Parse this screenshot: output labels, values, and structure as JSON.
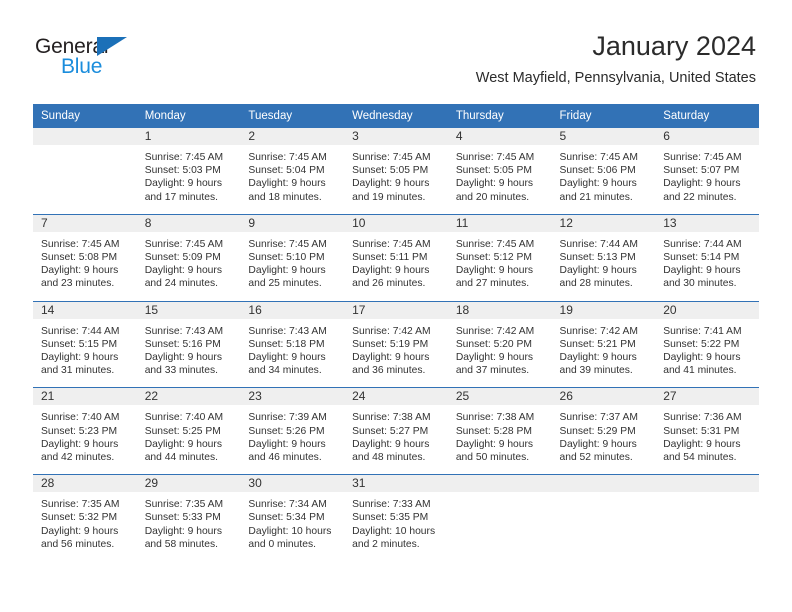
{
  "brand": {
    "line1": "General",
    "line2": "Blue",
    "triangle_color": "#1b70b8",
    "blue_color": "#1b8ddc"
  },
  "header": {
    "month_title": "January 2024",
    "location": "West Mayfield, Pennsylvania, United States"
  },
  "theme": {
    "header_blue": "#3272b6",
    "daynum_band": "#efefef",
    "text": "#333333"
  },
  "weekday_headers": [
    "Sunday",
    "Monday",
    "Tuesday",
    "Wednesday",
    "Thursday",
    "Friday",
    "Saturday"
  ],
  "weeks": [
    [
      {
        "day": "",
        "empty": true,
        "sunrise": "",
        "sunset": "",
        "daylight_line1": "",
        "daylight_line2": ""
      },
      {
        "day": "1",
        "sunrise": "Sunrise: 7:45 AM",
        "sunset": "Sunset: 5:03 PM",
        "daylight_line1": "Daylight: 9 hours",
        "daylight_line2": "and 17 minutes."
      },
      {
        "day": "2",
        "sunrise": "Sunrise: 7:45 AM",
        "sunset": "Sunset: 5:04 PM",
        "daylight_line1": "Daylight: 9 hours",
        "daylight_line2": "and 18 minutes."
      },
      {
        "day": "3",
        "sunrise": "Sunrise: 7:45 AM",
        "sunset": "Sunset: 5:05 PM",
        "daylight_line1": "Daylight: 9 hours",
        "daylight_line2": "and 19 minutes."
      },
      {
        "day": "4",
        "sunrise": "Sunrise: 7:45 AM",
        "sunset": "Sunset: 5:05 PM",
        "daylight_line1": "Daylight: 9 hours",
        "daylight_line2": "and 20 minutes."
      },
      {
        "day": "5",
        "sunrise": "Sunrise: 7:45 AM",
        "sunset": "Sunset: 5:06 PM",
        "daylight_line1": "Daylight: 9 hours",
        "daylight_line2": "and 21 minutes."
      },
      {
        "day": "6",
        "sunrise": "Sunrise: 7:45 AM",
        "sunset": "Sunset: 5:07 PM",
        "daylight_line1": "Daylight: 9 hours",
        "daylight_line2": "and 22 minutes."
      }
    ],
    [
      {
        "day": "7",
        "sunrise": "Sunrise: 7:45 AM",
        "sunset": "Sunset: 5:08 PM",
        "daylight_line1": "Daylight: 9 hours",
        "daylight_line2": "and 23 minutes."
      },
      {
        "day": "8",
        "sunrise": "Sunrise: 7:45 AM",
        "sunset": "Sunset: 5:09 PM",
        "daylight_line1": "Daylight: 9 hours",
        "daylight_line2": "and 24 minutes."
      },
      {
        "day": "9",
        "sunrise": "Sunrise: 7:45 AM",
        "sunset": "Sunset: 5:10 PM",
        "daylight_line1": "Daylight: 9 hours",
        "daylight_line2": "and 25 minutes."
      },
      {
        "day": "10",
        "sunrise": "Sunrise: 7:45 AM",
        "sunset": "Sunset: 5:11 PM",
        "daylight_line1": "Daylight: 9 hours",
        "daylight_line2": "and 26 minutes."
      },
      {
        "day": "11",
        "sunrise": "Sunrise: 7:45 AM",
        "sunset": "Sunset: 5:12 PM",
        "daylight_line1": "Daylight: 9 hours",
        "daylight_line2": "and 27 minutes."
      },
      {
        "day": "12",
        "sunrise": "Sunrise: 7:44 AM",
        "sunset": "Sunset: 5:13 PM",
        "daylight_line1": "Daylight: 9 hours",
        "daylight_line2": "and 28 minutes."
      },
      {
        "day": "13",
        "sunrise": "Sunrise: 7:44 AM",
        "sunset": "Sunset: 5:14 PM",
        "daylight_line1": "Daylight: 9 hours",
        "daylight_line2": "and 30 minutes."
      }
    ],
    [
      {
        "day": "14",
        "sunrise": "Sunrise: 7:44 AM",
        "sunset": "Sunset: 5:15 PM",
        "daylight_line1": "Daylight: 9 hours",
        "daylight_line2": "and 31 minutes."
      },
      {
        "day": "15",
        "sunrise": "Sunrise: 7:43 AM",
        "sunset": "Sunset: 5:16 PM",
        "daylight_line1": "Daylight: 9 hours",
        "daylight_line2": "and 33 minutes."
      },
      {
        "day": "16",
        "sunrise": "Sunrise: 7:43 AM",
        "sunset": "Sunset: 5:18 PM",
        "daylight_line1": "Daylight: 9 hours",
        "daylight_line2": "and 34 minutes."
      },
      {
        "day": "17",
        "sunrise": "Sunrise: 7:42 AM",
        "sunset": "Sunset: 5:19 PM",
        "daylight_line1": "Daylight: 9 hours",
        "daylight_line2": "and 36 minutes."
      },
      {
        "day": "18",
        "sunrise": "Sunrise: 7:42 AM",
        "sunset": "Sunset: 5:20 PM",
        "daylight_line1": "Daylight: 9 hours",
        "daylight_line2": "and 37 minutes."
      },
      {
        "day": "19",
        "sunrise": "Sunrise: 7:42 AM",
        "sunset": "Sunset: 5:21 PM",
        "daylight_line1": "Daylight: 9 hours",
        "daylight_line2": "and 39 minutes."
      },
      {
        "day": "20",
        "sunrise": "Sunrise: 7:41 AM",
        "sunset": "Sunset: 5:22 PM",
        "daylight_line1": "Daylight: 9 hours",
        "daylight_line2": "and 41 minutes."
      }
    ],
    [
      {
        "day": "21",
        "sunrise": "Sunrise: 7:40 AM",
        "sunset": "Sunset: 5:23 PM",
        "daylight_line1": "Daylight: 9 hours",
        "daylight_line2": "and 42 minutes."
      },
      {
        "day": "22",
        "sunrise": "Sunrise: 7:40 AM",
        "sunset": "Sunset: 5:25 PM",
        "daylight_line1": "Daylight: 9 hours",
        "daylight_line2": "and 44 minutes."
      },
      {
        "day": "23",
        "sunrise": "Sunrise: 7:39 AM",
        "sunset": "Sunset: 5:26 PM",
        "daylight_line1": "Daylight: 9 hours",
        "daylight_line2": "and 46 minutes."
      },
      {
        "day": "24",
        "sunrise": "Sunrise: 7:38 AM",
        "sunset": "Sunset: 5:27 PM",
        "daylight_line1": "Daylight: 9 hours",
        "daylight_line2": "and 48 minutes."
      },
      {
        "day": "25",
        "sunrise": "Sunrise: 7:38 AM",
        "sunset": "Sunset: 5:28 PM",
        "daylight_line1": "Daylight: 9 hours",
        "daylight_line2": "and 50 minutes."
      },
      {
        "day": "26",
        "sunrise": "Sunrise: 7:37 AM",
        "sunset": "Sunset: 5:29 PM",
        "daylight_line1": "Daylight: 9 hours",
        "daylight_line2": "and 52 minutes."
      },
      {
        "day": "27",
        "sunrise": "Sunrise: 7:36 AM",
        "sunset": "Sunset: 5:31 PM",
        "daylight_line1": "Daylight: 9 hours",
        "daylight_line2": "and 54 minutes."
      }
    ],
    [
      {
        "day": "28",
        "sunrise": "Sunrise: 7:35 AM",
        "sunset": "Sunset: 5:32 PM",
        "daylight_line1": "Daylight: 9 hours",
        "daylight_line2": "and 56 minutes."
      },
      {
        "day": "29",
        "sunrise": "Sunrise: 7:35 AM",
        "sunset": "Sunset: 5:33 PM",
        "daylight_line1": "Daylight: 9 hours",
        "daylight_line2": "and 58 minutes."
      },
      {
        "day": "30",
        "sunrise": "Sunrise: 7:34 AM",
        "sunset": "Sunset: 5:34 PM",
        "daylight_line1": "Daylight: 10 hours",
        "daylight_line2": "and 0 minutes."
      },
      {
        "day": "31",
        "sunrise": "Sunrise: 7:33 AM",
        "sunset": "Sunset: 5:35 PM",
        "daylight_line1": "Daylight: 10 hours",
        "daylight_line2": "and 2 minutes."
      },
      {
        "day": "",
        "empty": true,
        "sunrise": "",
        "sunset": "",
        "daylight_line1": "",
        "daylight_line2": ""
      },
      {
        "day": "",
        "empty": true,
        "sunrise": "",
        "sunset": "",
        "daylight_line1": "",
        "daylight_line2": ""
      },
      {
        "day": "",
        "empty": true,
        "sunrise": "",
        "sunset": "",
        "daylight_line1": "",
        "daylight_line2": ""
      }
    ]
  ]
}
